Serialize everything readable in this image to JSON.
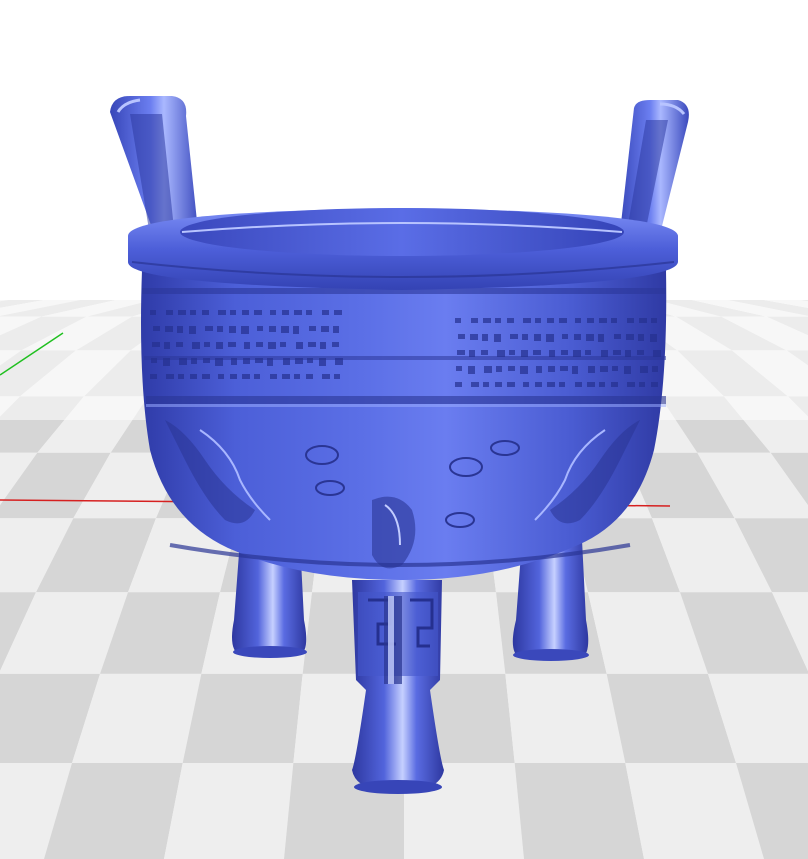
{
  "viewer": {
    "scene": "3d-model-preview",
    "model_name": "",
    "background_color": "#ffffff",
    "model_color": "#4a5fd6",
    "model_highlight_color": "#9fb0ff",
    "model_shadow_color": "#2a338f",
    "floor_tile_light": "#eeeeee",
    "floor_tile_dark": "#d6d6d6",
    "axes": {
      "x_color": "#d62020",
      "y_color": "#20c020"
    }
  }
}
